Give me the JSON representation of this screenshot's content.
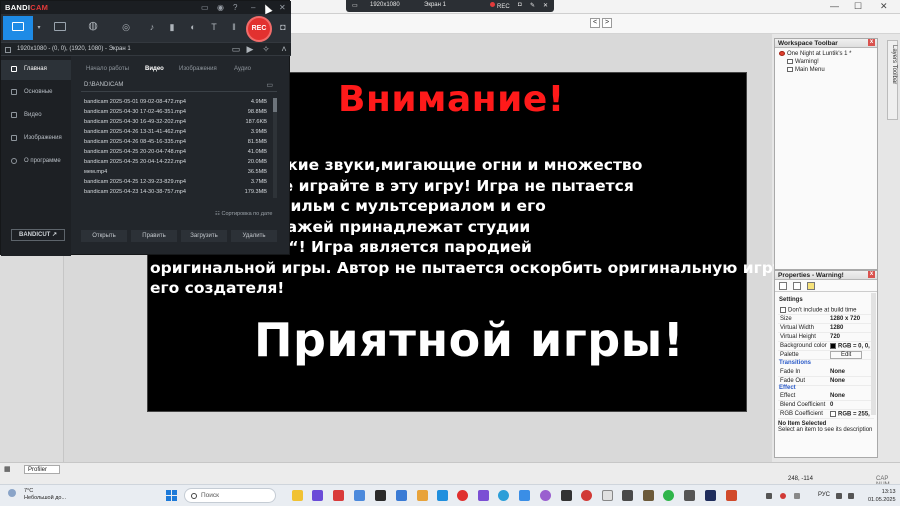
{
  "bandicam": {
    "logo_main": "BANDI",
    "logo_accent": "CAM",
    "rec_label": "REC",
    "info": "1920x1080 - (0, 0), (1920, 1080) - Экран 1",
    "sidebar": [
      "Главная",
      "Основные",
      "Видео",
      "Изображения",
      "О программе"
    ],
    "bandicut_label": "BANDICUT ↗",
    "tabs": [
      "Начало работы",
      "Видео",
      "Изображения",
      "Аудио"
    ],
    "path": "D:\\BANDICAM",
    "files": [
      {
        "name": "bandicam 2025-05-01 09-02-08-472.mp4",
        "size": "4.9MB"
      },
      {
        "name": "bandicam 2025-04-30 17-02-46-351.mp4",
        "size": "98.8MB"
      },
      {
        "name": "bandicam 2025-04-30 16-49-32-202.mp4",
        "size": "187.6KB"
      },
      {
        "name": "bandicam 2025-04-26 13-31-41-462.mp4",
        "size": "3.9MB"
      },
      {
        "name": "bandicam 2025-04-26 08-45-16-335.mp4",
        "size": "81.5MB"
      },
      {
        "name": "bandicam 2025-04-25 20-20-04-748.mp4",
        "size": "41.0MB"
      },
      {
        "name": "bandicam 2025-04-25 20-04-14-222.mp4",
        "size": "20.0MB"
      },
      {
        "name": "мем.mp4",
        "size": "36.5MB"
      },
      {
        "name": "bandicam 2025-04-25 12-39-23-829.mp4",
        "size": "3.7MB"
      },
      {
        "name": "bandicam 2025-04-23 14-30-38-757.mp4",
        "size": "179.3MB"
      }
    ],
    "sort_label": "Сортировка по дате",
    "actions": [
      "Открыть",
      "Править",
      "Загрузить",
      "Удалить"
    ]
  },
  "overlay": {
    "resolution": "1920x1080",
    "screen": "Экран 1",
    "rec": "REC"
  },
  "canvas": {
    "title": "Внимание!",
    "lines": [
      "исутствуют резкие звуки,мигающие огни и множество",
      "ы элептик то не играйте в эту игру! Игра не пытается",
      "альные мультфильм с мультсериалом и его",
      "рава на персонажей принадлежат студии",
      "ино “Мельница“! Игра является пародией",
      "оригинальной игры. Автор не пытается оскорбить оригинальную игру и",
      "его создателя!"
    ],
    "bottom": "Приятной игры!"
  },
  "workspace": {
    "title": "Workspace Toolbar",
    "close": "x",
    "root": "One Night at Luntik's 1 *",
    "items": [
      "Warning!",
      "Main Menu"
    ]
  },
  "layers_toolbar": "Layers Toolbar",
  "properties": {
    "title": "Properties - Warning!",
    "close": "x",
    "settings_header": "Settings",
    "dont_include": "Don't include at build time",
    "rows": [
      {
        "k": "Size",
        "v": "1280 x 720"
      },
      {
        "k": "Virtual Width",
        "v": "1280"
      },
      {
        "k": "Virtual Height",
        "v": "720"
      },
      {
        "k": "Background color",
        "v": "RGB = 0, 0,"
      },
      {
        "k": "Palette",
        "v": "Edit"
      }
    ],
    "transitions_header": "Transitions",
    "transition_rows": [
      {
        "k": "Fade In",
        "v": "None"
      },
      {
        "k": "Fade Out",
        "v": "None"
      }
    ],
    "effect_header": "Effect",
    "effect_rows": [
      {
        "k": "Effect",
        "v": "None"
      },
      {
        "k": "Blend Coefficient",
        "v": "0"
      },
      {
        "k": "RGB Coefficient",
        "v": "RGB = 255,"
      }
    ],
    "no_item_title": "No Item Selected",
    "no_item_desc": "Select an item to see its description"
  },
  "statusbar": {
    "profiler": "Profiler",
    "coords": "248, -114",
    "capnum": "CAP NUM"
  },
  "taskbar": {
    "weather_temp": "7°C",
    "weather_desc": "Небольшой до...",
    "search_placeholder": "Поиск",
    "lang": "РУС",
    "time": "13:13",
    "date": "01.05.2025"
  }
}
